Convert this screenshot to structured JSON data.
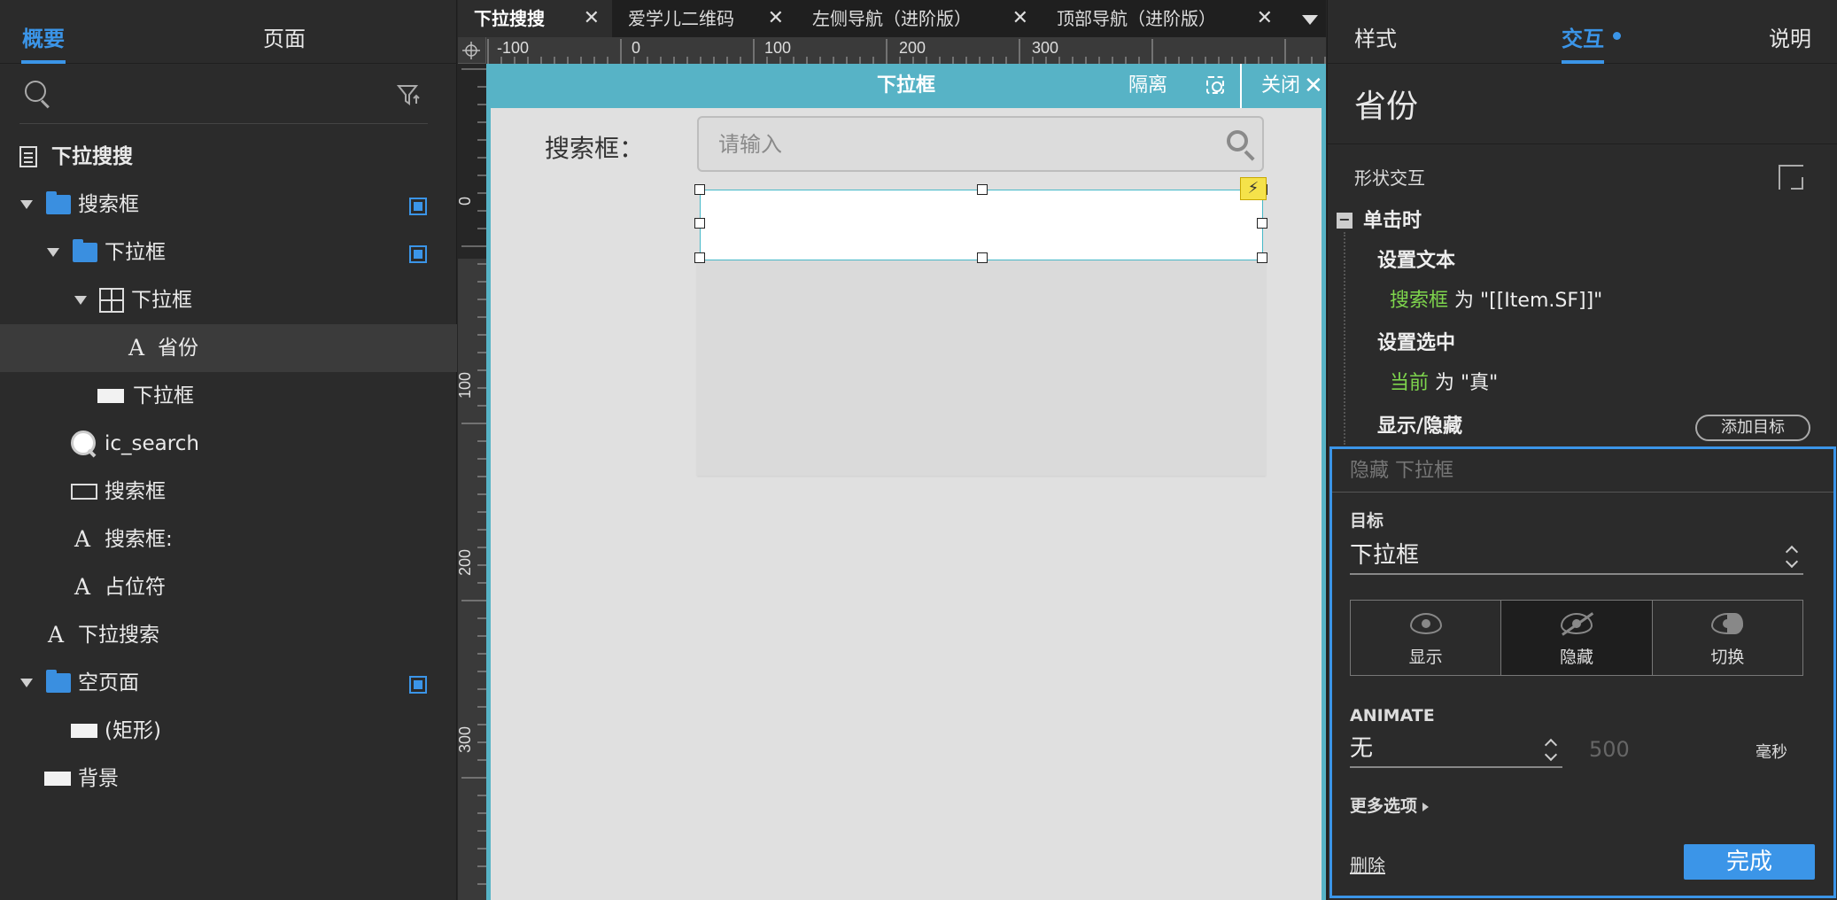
{
  "left_panel": {
    "tabs": [
      {
        "label": "概要",
        "active": true
      },
      {
        "label": "页面",
        "active": false
      }
    ],
    "tree": [
      {
        "label": "下拉搜搜",
        "icon": "page-icon"
      },
      {
        "label": "搜索框",
        "icon": "folder-icon"
      },
      {
        "label": "下拉框",
        "icon": "folder-icon"
      },
      {
        "label": "下拉框",
        "icon": "dynamic-panel-icon"
      },
      {
        "label": "省份",
        "icon": "text-icon"
      },
      {
        "label": "下拉框",
        "icon": "rectangle-icon"
      },
      {
        "label": "ic_search",
        "icon": "image-icon"
      },
      {
        "label": "搜索框",
        "icon": "text-field-icon"
      },
      {
        "label": "搜索框:",
        "icon": "text-icon"
      },
      {
        "label": "占位符",
        "icon": "text-icon"
      },
      {
        "label": "下拉搜索",
        "icon": "text-icon"
      },
      {
        "label": "空页面",
        "icon": "folder-icon"
      },
      {
        "label": "(矩形)",
        "icon": "rectangle-icon"
      },
      {
        "label": "背景",
        "icon": "rectangle-icon"
      }
    ]
  },
  "document_tabs": [
    {
      "label": "下拉搜搜",
      "active": true
    },
    {
      "label": "爱学儿二维码",
      "active": false
    },
    {
      "label": "左侧导航（进阶版）",
      "active": false
    },
    {
      "label": "顶部导航（进阶版）",
      "active": false
    }
  ],
  "ruler": {
    "h_labels": [
      "-100",
      "0",
      "100",
      "200",
      "300"
    ],
    "v_labels": [
      "0",
      "100",
      "200",
      "300"
    ]
  },
  "canvas": {
    "edit_title": "下拉框",
    "isolate_label": "隔离",
    "close_label": "关闭",
    "close_glyph": "✕",
    "search_label": "搜索框：",
    "search_placeholder": "请输入",
    "bolt": "⚡"
  },
  "right_panel": {
    "tabs": [
      {
        "label": "样式",
        "active": false
      },
      {
        "label": "交互",
        "active": true
      },
      {
        "label": "说明",
        "active": false
      }
    ],
    "element_name": "省份",
    "section_title": "形状交互",
    "event": "单击时",
    "minus": "−",
    "action1_title": "设置文本",
    "action1_target": "搜索框",
    "action1_rest": "为 \"[[Item.SF]]\"",
    "action2_title": "设置选中",
    "action2_target": "当前",
    "action2_rest": "为 \"真\"",
    "action3_title": "显示/隐藏",
    "add_target": "添加目标",
    "editor": {
      "title": "隐藏 下拉框",
      "target_label": "目标",
      "target_value": "下拉框",
      "options": [
        "显示",
        "隐藏",
        "切换"
      ],
      "selected_option": "隐藏",
      "animate_label": "ANIMATE",
      "animate_value": "无",
      "duration": "500",
      "unit": "毫秒",
      "more_options": "更多选项",
      "delete": "删除",
      "done": "完成"
    }
  },
  "colors": {
    "accent": "#3b95e8",
    "edit_bar": "#57b3c6",
    "action_target": "#7ed54d"
  }
}
